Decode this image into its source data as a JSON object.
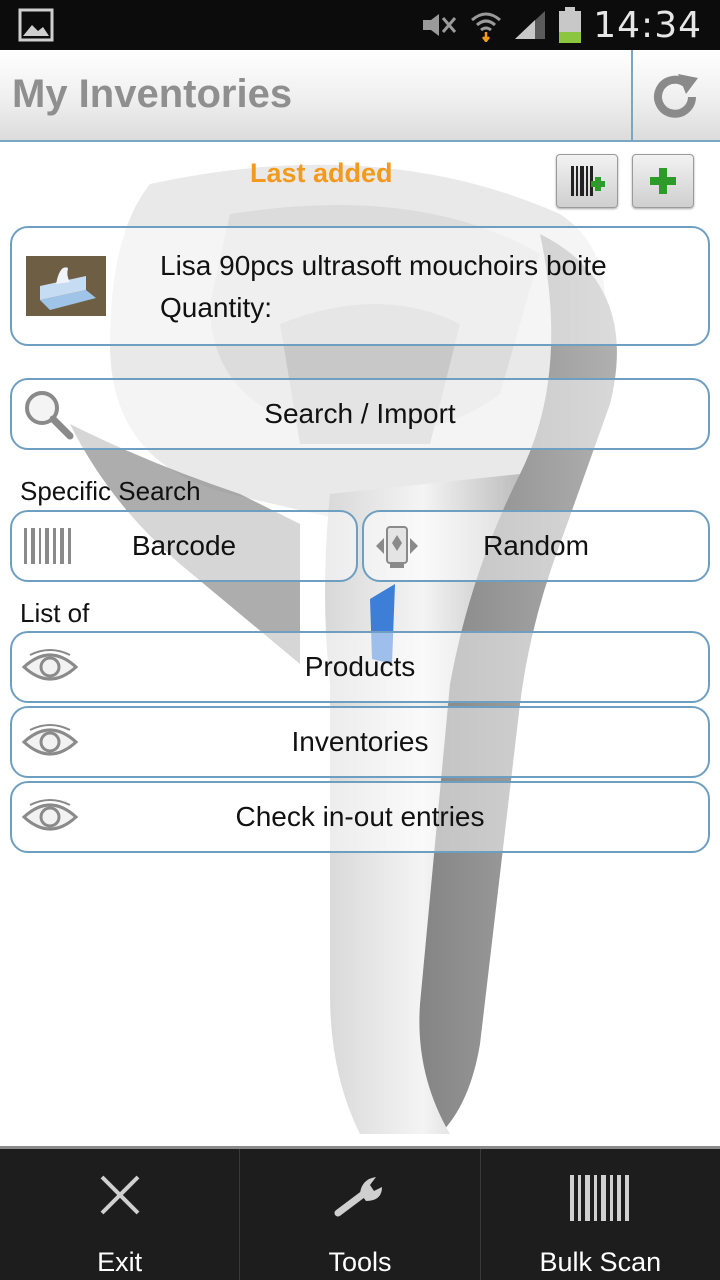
{
  "status_bar": {
    "time": "14:34",
    "icons": [
      "gallery-icon",
      "mute-icon",
      "wifi-icon",
      "signal-icon",
      "battery-icon"
    ]
  },
  "action_bar": {
    "title": "My Inventories",
    "refresh_icon": "refresh-icon"
  },
  "header": {
    "last_added": "Last added"
  },
  "last_item": {
    "name": "Lisa 90pcs ultrasoft mouchoirs boite",
    "quantity_label": "Quantity:"
  },
  "search": {
    "label": "Search / Import",
    "icon": "magnifier-icon"
  },
  "specific_search": {
    "heading": "Specific Search",
    "barcode_label": "Barcode",
    "random_label": "Random"
  },
  "list_of": {
    "heading": "List of",
    "items": [
      {
        "label": "Products",
        "icon": "eye-icon"
      },
      {
        "label": "Inventories",
        "icon": "eye-icon"
      },
      {
        "label": "Check in-out entries",
        "icon": "eye-icon"
      }
    ]
  },
  "bottom_bar": {
    "tabs": [
      {
        "label": "Exit",
        "icon": "close-icon"
      },
      {
        "label": "Tools",
        "icon": "wrench-icon"
      },
      {
        "label": "Bulk Scan",
        "icon": "barcode-icon"
      }
    ]
  },
  "colors": {
    "accent": "#f39a1e",
    "border": "#6f9fc0",
    "title": "#8f8f8f",
    "add_green": "#2e9a2a"
  }
}
